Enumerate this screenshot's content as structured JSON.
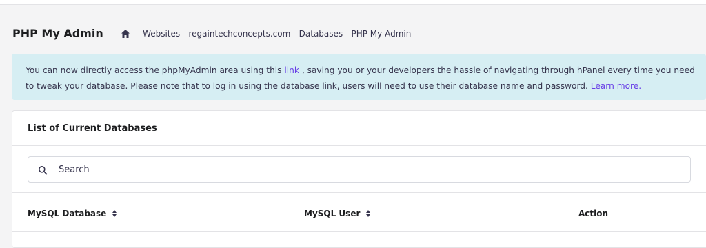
{
  "header": {
    "title": "PHP My Admin",
    "breadcrumb": [
      "Websites",
      "regaintechconcepts.com",
      "Databases",
      "PHP My Admin"
    ],
    "separator": "-"
  },
  "notice": {
    "text_before_link": "You can now directly access the phpMyAdmin area using this ",
    "link_label": "link",
    "text_middle": " , saving you or your developers the hassle of navigating through hPanel every time you need to tweak your database. Please note that to log in using the database link, users will need to use their database name and password. ",
    "learn_more_label": "Learn more.",
    "background": "#d6eef3",
    "link_color": "#673de6"
  },
  "databases_card": {
    "title": "List of Current Databases",
    "search": {
      "placeholder": "Search",
      "value": ""
    },
    "columns": [
      "MySQL Database",
      "MySQL User",
      "Action"
    ]
  },
  "icons": {
    "home": "home-icon",
    "search": "search-icon",
    "sort": "sort-icon"
  }
}
